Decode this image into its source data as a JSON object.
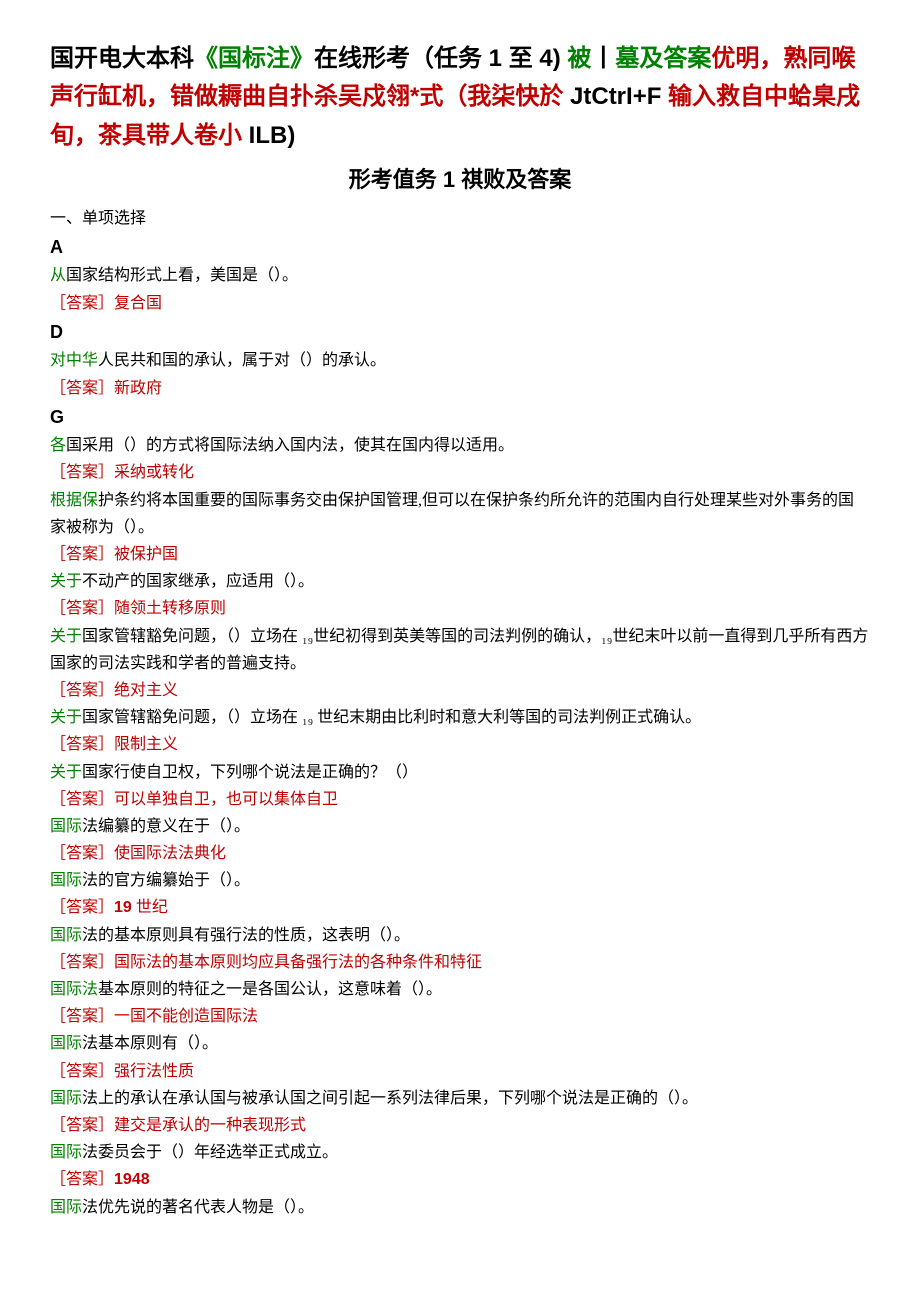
{
  "title_line": {
    "p1": "国开电大本科",
    "p2": "《国标注》",
    "p3": "在线形考（任务 ",
    "p4": "1",
    "p5": " 至 ",
    "p6": "4",
    "p7": ") ",
    "p8": "被",
    "p9": "丨",
    "p10": "墓及答案",
    "p11": "优明，熟同喉声行缸机，错做耨曲自扑杀吴戍翎*式（我柒快於 ",
    "p12": "JtCtrI+F",
    "p13": " 输入救自中蛤臬戌旬，茶具带人卷小 ",
    "p14": "ILB)"
  },
  "subtitle": "形考值务 1 祺败及答案",
  "section1": "一、单项选择",
  "groups": [
    {
      "letter": "A",
      "items": [
        {
          "q_pre": "从",
          "q_rest": "国家结构形式上看，美国是（）。",
          "a": "［答案］复合国"
        }
      ]
    },
    {
      "letter": "D",
      "items": [
        {
          "q_pre": "对中华",
          "q_rest": "人民共和国的承认，属于对（）的承认。",
          "a": "［答案］新政府"
        }
      ]
    },
    {
      "letter": "G",
      "items": [
        {
          "q_pre": "各",
          "q_rest": "国采用（）的方式将国际法纳入国内法，使其在国内得以适用。",
          "a": "［答案］采纳或转化"
        },
        {
          "q_pre": "根据保",
          "q_rest": "护条约将本国重要的国际事务交由保护国管理,但可以在保护条约所允许的范围内自行处理某些对外事务的国家被称为（）。",
          "a": "［答案］被保护国"
        },
        {
          "q_pre": "关于",
          "q_rest": "不动产的国家继承，应适用（）。",
          "a": "［答案］随领土转移原则"
        },
        {
          "q_pre": "关于",
          "q_rest": "国家管辖豁免问题，（）立场在 ₁₉世纪初得到英美等国的司法判例的确认，₁₉世纪末叶以前一直得到几乎所有西方国家的司法实践和学者的普遍支持。",
          "a": "［答案］绝对主义"
        },
        {
          "q_pre": "关于",
          "q_rest": "国家管辖豁免问题，（）立场在 ₁₉ 世纪末期由比利时和意大利等国的司法判例正式确认。",
          "a": "［答案］限制主义"
        },
        {
          "q_pre": "关于",
          "q_rest": "国家行使自卫权，下列哪个说法是正确的？（）",
          "a": "［答案］可以单独自卫，也可以集体自卫"
        },
        {
          "q_pre": "国际",
          "q_rest": "法编纂的意义在于（）。",
          "a": "［答案］使国际法法典化"
        },
        {
          "q_pre": "国际",
          "q_rest": "法的官方编纂始于（）。",
          "a": "［答案］",
          "a_num": "19",
          "a_tail": " 世纪"
        },
        {
          "q_pre": "国际",
          "q_rest": "法的基本原则具有强行法的性质，这表明（）。",
          "a": "［答案］国际法的基本原则均应具备强行法的各种条件和特征"
        },
        {
          "q_pre": "国际法",
          "q_rest": "基本原则的特征之一是各国公认，这意味着（）。",
          "a": "［答案］一国不能创造国际法"
        },
        {
          "q_pre": "国际",
          "q_rest": "法基本原则有（）。",
          "a": "［答案］强行法性质"
        },
        {
          "q_pre": "国际",
          "q_rest": "法上的承认在承认国与被承认国之间引起一系列法律后果，下列哪个说法是正确的（）。",
          "a": "［答案］建交是承认的一种表现形式"
        },
        {
          "q_pre": "国际",
          "q_rest": "法委员会于（）年经选举正式成立。",
          "a": "［答案］",
          "a_num": "1948"
        },
        {
          "q_pre": "国际",
          "q_rest": "法优先说的著名代表人物是（）。",
          "a": ""
        }
      ]
    }
  ]
}
